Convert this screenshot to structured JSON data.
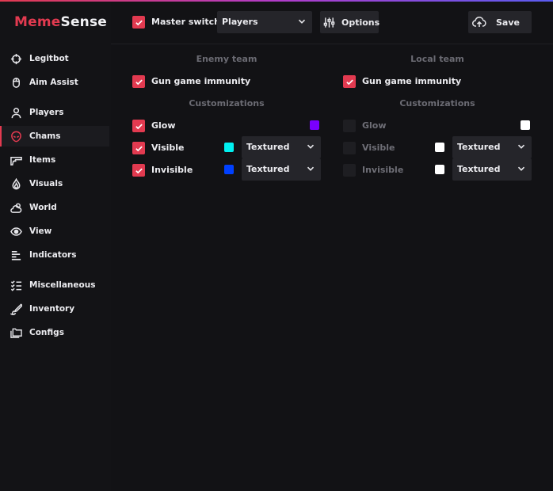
{
  "brand": {
    "part1": "Meme",
    "part2": "Sense"
  },
  "sidebar": {
    "items": [
      {
        "label": "Legitbot",
        "icon": "crosshair-icon"
      },
      {
        "label": "Aim Assist",
        "icon": "mouse-icon"
      },
      {
        "label": "Players",
        "icon": "user-icon"
      },
      {
        "label": "Chams",
        "icon": "alien-icon",
        "active": true
      },
      {
        "label": "Items",
        "icon": "gun-icon"
      },
      {
        "label": "Visuals",
        "icon": "flame-icon"
      },
      {
        "label": "World",
        "icon": "cloud-sun-icon"
      },
      {
        "label": "View",
        "icon": "eye-icon"
      },
      {
        "label": "Indicators",
        "icon": "bars-icon"
      },
      {
        "label": "Miscellaneous",
        "icon": "checklist-icon"
      },
      {
        "label": "Inventory",
        "icon": "brush-icon"
      },
      {
        "label": "Configs",
        "icon": "folders-icon"
      }
    ]
  },
  "header": {
    "master_switch_label": "Master switch",
    "master_switch_checked": true,
    "category_select": "Players",
    "options_label": "Options",
    "save_label": "Save"
  },
  "enemy": {
    "title": "Enemy team",
    "gun_game_immunity": "Gun game immunity",
    "customizations": "Customizations",
    "glow": {
      "label": "Glow",
      "checked": true,
      "color": "#7a00ff"
    },
    "visible": {
      "label": "Visible",
      "checked": true,
      "color": "#00f0f0",
      "material": "Textured"
    },
    "invisible": {
      "label": "Invisible",
      "checked": true,
      "color": "#0040ff",
      "material": "Textured"
    }
  },
  "local": {
    "title": "Local team",
    "gun_game_immunity": "Gun game immunity",
    "customizations": "Customizations",
    "glow": {
      "label": "Glow",
      "checked": false,
      "color": "#ffffff"
    },
    "visible": {
      "label": "Visible",
      "checked": false,
      "color": "#ffffff",
      "material": "Textured"
    },
    "invisible": {
      "label": "Invisible",
      "checked": false,
      "color": "#ffffff",
      "material": "Textured"
    }
  },
  "colors": {
    "accent": "#e23a50",
    "panel": "#121215",
    "control": "#25252a"
  }
}
